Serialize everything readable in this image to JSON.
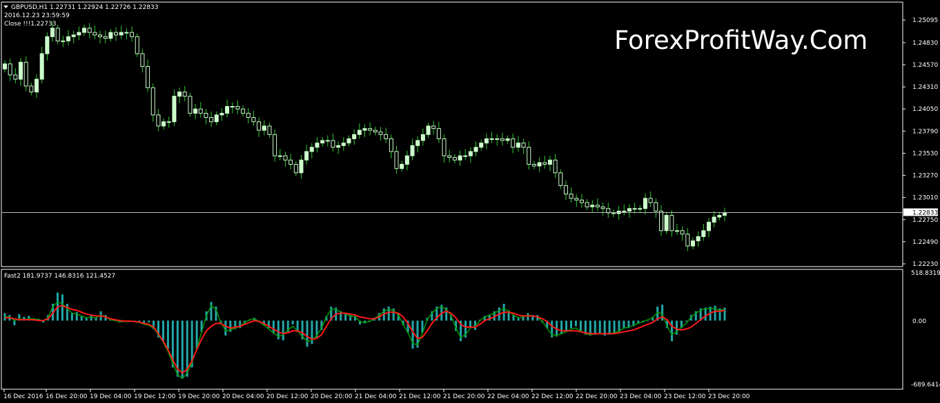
{
  "main_panel": {
    "symbol_header": "GBPUSD,H1  1.22731 1.22924 1.22726 1.22833",
    "datetime": "2016.12.23 23:59:59",
    "close_label": "Close !!!1.22733",
    "watermark": "ForexProfitWay.Com",
    "current_price_label": "1.22833"
  },
  "indicator_panel": {
    "header": "Fast2 181.9737 146.8316 121.4527",
    "top_label": "518.8319",
    "zero_label": "0.00",
    "bottom_label": "-689.6414"
  },
  "colors": {
    "background": "#000000",
    "grid_line": "#ffffff",
    "candle_body": "#ccffcc",
    "wick": "#33cc33",
    "histogram": "#22a8a8",
    "fast_line": "#009900",
    "slow_line": "#ff1a1a",
    "price_line": "#bbbbbb"
  },
  "chart_data": [
    {
      "type": "candlestick",
      "title": "GBPUSD,H1",
      "ylim": [
        1.2223,
        1.2525
      ],
      "y_ticks": [
        "1.25095",
        "1.24830",
        "1.24570",
        "1.24310",
        "1.24050",
        "1.23790",
        "1.23530",
        "1.23270",
        "1.23010",
        "1.22750",
        "1.22490",
        "1.22230"
      ],
      "x_ticks": [
        "16 Dec 2016",
        "16 Dec 20:00",
        "19 Dec 04:00",
        "19 Dec 12:00",
        "19 Dec 20:00",
        "20 Dec 04:00",
        "20 Dec 12:00",
        "20 Dec 20:00",
        "21 Dec 04:00",
        "21 Dec 12:00",
        "21 Dec 20:00",
        "22 Dec 04:00",
        "22 Dec 12:00",
        "22 Dec 20:00",
        "23 Dec 04:00",
        "23 Dec 12:00",
        "23 Dec 20:00"
      ],
      "current_price": 1.22833,
      "close": [
        1.2458,
        1.2445,
        1.244,
        1.246,
        1.2432,
        1.2425,
        1.244,
        1.247,
        1.249,
        1.25,
        1.2485,
        1.2485,
        1.249,
        1.2492,
        1.2495,
        1.25,
        1.2495,
        1.2492,
        1.249,
        1.2488,
        1.2495,
        1.2492,
        1.2495,
        1.2495,
        1.249,
        1.247,
        1.2455,
        1.243,
        1.2398,
        1.2385,
        1.239,
        1.239,
        1.242,
        1.2425,
        1.242,
        1.24,
        1.2405,
        1.24,
        1.2395,
        1.239,
        1.2398,
        1.24,
        1.2408,
        1.2408,
        1.2405,
        1.24,
        1.2395,
        1.239,
        1.238,
        1.2385,
        1.2375,
        1.235,
        1.235,
        1.2345,
        1.234,
        1.233,
        1.2345,
        1.2355,
        1.236,
        1.2365,
        1.2368,
        1.2368,
        1.236,
        1.2362,
        1.2365,
        1.237,
        1.2375,
        1.238,
        1.2382,
        1.238,
        1.2378,
        1.2375,
        1.237,
        1.2355,
        1.2335,
        1.234,
        1.235,
        1.2362,
        1.2368,
        1.2375,
        1.2385,
        1.2382,
        1.237,
        1.235,
        1.2348,
        1.2345,
        1.235,
        1.235,
        1.2355,
        1.236,
        1.2365,
        1.237,
        1.237,
        1.237,
        1.2368,
        1.237,
        1.236,
        1.2365,
        1.236,
        1.234,
        1.2338,
        1.2342,
        1.234,
        1.2345,
        1.233,
        1.2315,
        1.2305,
        1.23,
        1.2298,
        1.2295,
        1.229,
        1.2292,
        1.229,
        1.2288,
        1.2283,
        1.2282,
        1.2285,
        1.2285,
        1.2288,
        1.2288,
        1.2288,
        1.23,
        1.2295,
        1.2285,
        1.2262,
        1.228,
        1.2262,
        1.2262,
        1.2258,
        1.2244,
        1.225,
        1.2255,
        1.2262,
        1.2272,
        1.2278,
        1.228,
        1.2283
      ]
    },
    {
      "type": "histogram_with_lines",
      "title": "Fast2",
      "ylim": [
        -689.6414,
        518.8319
      ],
      "series": [
        {
          "style": "histogram",
          "values": [
            80,
            60,
            -50,
            70,
            40,
            50,
            20,
            20,
            -20,
            60,
            180,
            300,
            280,
            180,
            80,
            90,
            50,
            30,
            60,
            30,
            100,
            60,
            20,
            5,
            -20,
            -10,
            0,
            0,
            -10,
            -40,
            -20,
            -90,
            -180,
            -220,
            -300,
            -500,
            -600,
            -620,
            -600,
            -500,
            -300,
            -120,
            100,
            200,
            150,
            -40,
            -160,
            -120,
            -90,
            -80,
            -30,
            10,
            30,
            -5,
            -50,
            -80,
            -140,
            -200,
            -210,
            -120,
            -40,
            -120,
            -200,
            -280,
            -250,
            -180,
            -100,
            50,
            150,
            140,
            100,
            80,
            60,
            50,
            -40,
            -30,
            -10,
            30,
            80,
            130,
            150,
            130,
            80,
            -50,
            -130,
            -300,
            -290,
            -130,
            30,
            100,
            150,
            170,
            140,
            60,
            -110,
            -220,
            -180,
            -80,
            -100,
            10,
            50,
            60,
            100,
            140,
            180,
            110,
            60,
            30,
            50,
            80,
            60,
            60,
            -20,
            -80,
            -180,
            -170,
            -140,
            -120,
            -80,
            -60,
            -120,
            -150,
            -160,
            -150,
            -140,
            -160,
            -150,
            -140,
            -120,
            -80,
            -80,
            -60,
            -30,
            -20,
            0,
            40,
            150,
            170,
            -80,
            -220,
            -150,
            -80,
            -10,
            60,
            100,
            130,
            140,
            150,
            160,
            130,
            140
          ]
        },
        {
          "name": "146.8316",
          "style": "line",
          "values": [
            40,
            40,
            0,
            20,
            10,
            20,
            20,
            10,
            0,
            30,
            150,
            200,
            180,
            130,
            80,
            70,
            50,
            30,
            40,
            30,
            60,
            40,
            10,
            0,
            -10,
            -10,
            -10,
            -10,
            -20,
            -40,
            -50,
            -80,
            -150,
            -230,
            -330,
            -460,
            -580,
            -620,
            -560,
            -450,
            -300,
            -120,
            50,
            160,
            120,
            -20,
            -110,
            -100,
            -80,
            -60,
            -20,
            10,
            20,
            -10,
            -50,
            -90,
            -130,
            -170,
            -150,
            -100,
            -60,
            -110,
            -170,
            -220,
            -210,
            -160,
            -80,
            40,
            120,
            120,
            90,
            70,
            50,
            40,
            -10,
            -20,
            -10,
            20,
            60,
            100,
            120,
            110,
            60,
            -40,
            -130,
            -240,
            -260,
            -140,
            10,
            80,
            130,
            150,
            120,
            50,
            -80,
            -180,
            -150,
            -80,
            -60,
            0,
            40,
            60,
            80,
            110,
            130,
            100,
            60,
            30,
            40,
            60,
            50,
            40,
            -10,
            -80,
            -150,
            -160,
            -140,
            -120,
            -90,
            -80,
            -110,
            -140,
            -150,
            -140,
            -140,
            -140,
            -140,
            -130,
            -110,
            -80,
            -70,
            -50,
            -30,
            -10,
            10,
            30,
            90,
            70,
            -60,
            -150,
            -120,
            -70,
            -30,
            40,
            80,
            110,
            130,
            130,
            130,
            110,
            120
          ]
        },
        {
          "name": "121.4527",
          "style": "line",
          "values": [
            30,
            30,
            20,
            10,
            10,
            10,
            10,
            0,
            0,
            20,
            80,
            150,
            160,
            140,
            120,
            110,
            90,
            70,
            60,
            50,
            50,
            40,
            20,
            10,
            0,
            -5,
            -5,
            -10,
            -15,
            -30,
            -40,
            -70,
            -140,
            -220,
            -310,
            -420,
            -520,
            -560,
            -520,
            -430,
            -310,
            -200,
            -110,
            -60,
            -30,
            -30,
            -60,
            -80,
            -70,
            -60,
            -40,
            -20,
            0,
            -10,
            -30,
            -60,
            -90,
            -120,
            -140,
            -130,
            -110,
            -110,
            -130,
            -170,
            -200,
            -190,
            -150,
            -60,
            20,
            70,
            80,
            80,
            70,
            60,
            40,
            30,
            20,
            20,
            40,
            70,
            90,
            90,
            80,
            40,
            -30,
            -120,
            -190,
            -180,
            -110,
            -30,
            30,
            80,
            100,
            80,
            30,
            -40,
            -70,
            -70,
            -70,
            -40,
            0,
            20,
            40,
            70,
            90,
            90,
            80,
            60,
            50,
            50,
            50,
            40,
            20,
            -10,
            -60,
            -90,
            -110,
            -110,
            -110,
            -110,
            -120,
            -130,
            -140,
            -140,
            -140,
            -140,
            -140,
            -140,
            -130,
            -120,
            -110,
            -100,
            -80,
            -60,
            -40,
            -20,
            20,
            40,
            10,
            -60,
            -90,
            -100,
            -90,
            -70,
            -30,
            10,
            50,
            80,
            100,
            100,
            110
          ]
        }
      ]
    }
  ]
}
